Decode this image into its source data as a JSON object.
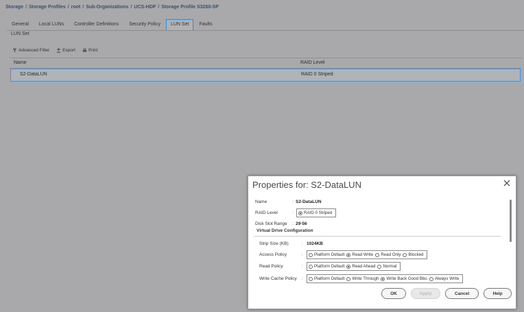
{
  "breadcrumb": [
    "Storage",
    "Storage Profiles",
    "root",
    "Sub-Organizations",
    "UCS-HDP",
    "Storage Profile S3260-SP"
  ],
  "tabs": [
    "General",
    "Local LUNs",
    "Controller Definitions",
    "Security Policy",
    "LUN Set",
    "Faults"
  ],
  "active_tab": "LUN Set",
  "subtab": "LUN Set",
  "toolbar": {
    "filter_label": "Advanced Filter",
    "export_label": "Export",
    "print_label": "Print"
  },
  "grid": {
    "columns": [
      "Name",
      "RAID Level"
    ],
    "rows": [
      {
        "name": "S2-DataLUN",
        "raid": "RAID 0 Striped"
      }
    ]
  },
  "dialog": {
    "title": "Properties for: S2-DataLUN",
    "name_label": "Name",
    "name_value": "S2-DataLUN",
    "raid_label": "RAID Level",
    "raid_value": "RAID 0 Striped",
    "range_label": "Disk Slot Range",
    "range_value": "29-56",
    "section_title": "Virtual Drive Configuration",
    "strip_label": "Strip Size (KB)",
    "strip_value": "1024KB",
    "access_label": "Access Policy",
    "access_options": [
      "Platform Default",
      "Read Write",
      "Read Only",
      "Blocked"
    ],
    "access_selected": "Read Write",
    "read_label": "Read Policy",
    "read_options": [
      "Platform Default",
      "Read Ahead",
      "Normal"
    ],
    "read_selected": "Read Ahead",
    "write_label": "Write Cache Policy",
    "write_options": [
      "Platform Default",
      "Write Through",
      "Write Back Good Bbu",
      "Always Write"
    ],
    "write_selected": "Write Back Good Bbu",
    "buttons": {
      "ok": "OK",
      "apply": "Apply",
      "cancel": "Cancel",
      "help": "Help"
    }
  }
}
